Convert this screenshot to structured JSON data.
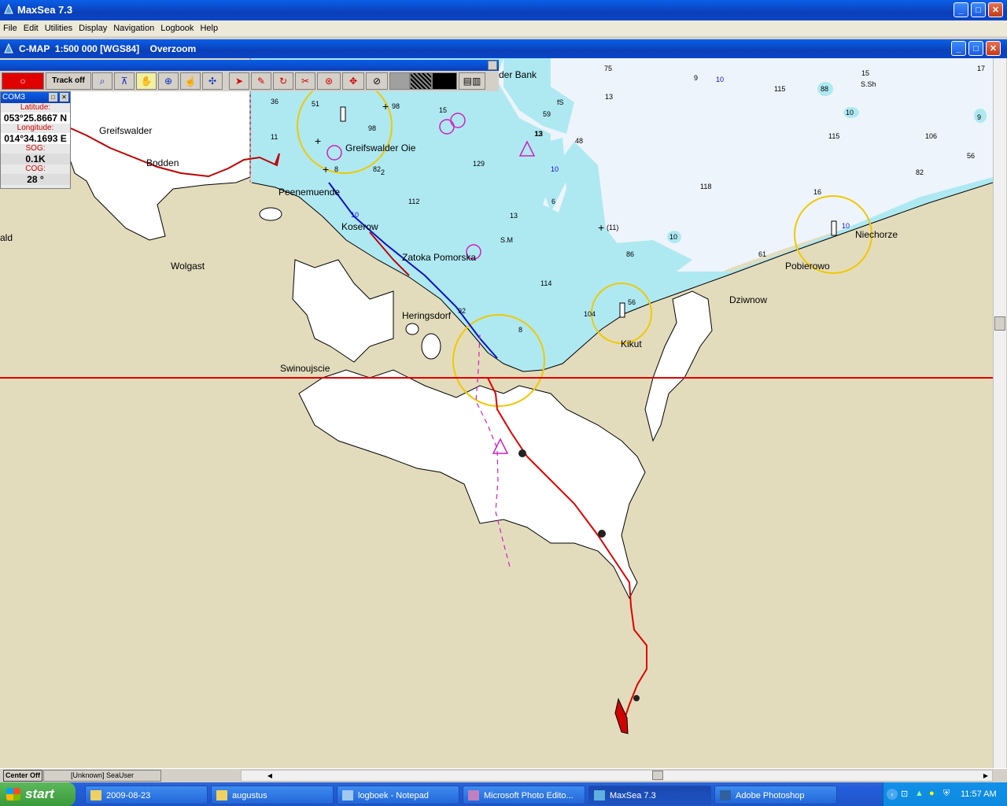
{
  "app": {
    "title": "MaxSea 7.3",
    "menu": [
      "File",
      "Edit",
      "Utilities",
      "Display",
      "Navigation",
      "Logbook",
      "Help"
    ]
  },
  "chart_window": {
    "title": "C-MAP  1:500 000 [WGS84]    Overzoom"
  },
  "toolbar": {
    "track_button": "Track off",
    "tools": [
      "zoom-icon",
      "compass-icon",
      "hand-icon",
      "crosshair-icon",
      "pan-icon",
      "route-icon",
      "cursor-icon",
      "pencil-icon",
      "rotate-icon",
      "scissors-icon",
      "target-icon",
      "move-icon",
      "circle-icon"
    ]
  },
  "com_panel": {
    "port": "COM3",
    "latitude_label": "Latitude:",
    "latitude": "053°25.8667 N",
    "longitude_label": "Longitude:",
    "longitude": "014°34.1693 E",
    "sog_label": "SOG:",
    "sog": "0.1K",
    "cog_label": "COG:",
    "cog": "28 °"
  },
  "map": {
    "place_labels": {
      "greifswalder": "Greifswalder",
      "bodden": "Bodden",
      "greifswalder_oie": "Greifswalder Oie",
      "peenemuende": "Peenemuende",
      "koserow": "Koserow",
      "zatoka": "Zatoka Pomorska",
      "wolgast": "Wolgast",
      "heringsdorf": "Heringsdorf",
      "swinoujscie": "Swinoujscie",
      "kikut": "Kikut",
      "dziwnow": "Dziwnow",
      "pobierowo": "Pobierowo",
      "niechorze": "Niechorze",
      "bank": "der Bank",
      "ald": "ald",
      "sm": "S.M",
      "ssh": "S.Sh",
      "fs": "fS",
      "mark11": "(11)"
    },
    "depths": {
      "d1": "36",
      "d2": "51",
      "d3": "98",
      "d4": "15",
      "d5": "13",
      "d6": "59",
      "d7": "75",
      "d8": "13",
      "d9": "9",
      "d10": "10",
      "d11": "115",
      "d12": "88",
      "d13": "15",
      "d14": "17",
      "d15": "10",
      "d16": "9",
      "d17": "11",
      "d18": "98",
      "d19": "13",
      "d20": "48",
      "d21": "129",
      "d22": "82",
      "d23": "112",
      "d24": "13",
      "d25": "6",
      "d26": "118",
      "d27": "115",
      "d28": "106",
      "d29": "56",
      "d30": "82",
      "d31": "16",
      "d32": "10",
      "d33": "86",
      "d34": "61",
      "d35": "114",
      "d36": "92",
      "d37": "8",
      "d38": "104",
      "d39": "56",
      "d40": "10",
      "d41": "10",
      "d42": "10",
      "d43": "2",
      "d44": "8"
    }
  },
  "statusbar": {
    "center_off": "Center Off",
    "user": "[Unknown] SeaUser"
  },
  "taskbar": {
    "start": "start",
    "items": [
      "2009-08-23",
      "augustus",
      "logboek - Notepad",
      "Microsoft Photo Edito...",
      "MaxSea 7.3",
      "Adobe Photoshop"
    ],
    "clock": "11:57 AM"
  },
  "colors": {
    "land": "#e3dcbc",
    "shallow": "#aee9f2",
    "deep": "#eef4fb",
    "track": "#d40000",
    "route": "#1010c8",
    "light_circle": "#f0c800"
  }
}
